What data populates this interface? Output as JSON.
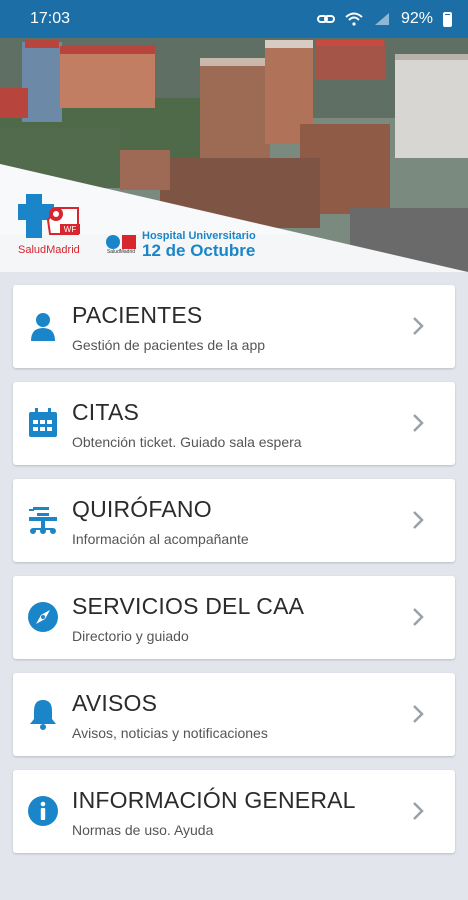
{
  "status_bar": {
    "time": "17:03",
    "battery": "92%"
  },
  "header": {
    "left_logo": {
      "badge_text": "WF",
      "name": "SaludMadrid"
    },
    "right_logo": {
      "small": "SaludMadrid",
      "line1": "Hospital Universitario",
      "line2": "12 de Octubre"
    }
  },
  "colors": {
    "accent": "#1a86c9",
    "status_bar": "#1c6fa6",
    "background": "#e2e6ec",
    "logo_red": "#d7262e"
  },
  "menu": [
    {
      "title": "PACIENTES",
      "subtitle": "Gestión de pacientes de la app",
      "icon": "person-icon"
    },
    {
      "title": "CITAS",
      "subtitle": "Obtención ticket. Guiado sala espera",
      "icon": "calendar-icon"
    },
    {
      "title": "QUIRÓFANO",
      "subtitle": "Información al acompañante",
      "icon": "operating-table-icon"
    },
    {
      "title": "SERVICIOS DEL CAA",
      "subtitle": "Directorio y guiado",
      "icon": "compass-icon"
    },
    {
      "title": "AVISOS",
      "subtitle": "Avisos, noticias y notificaciones",
      "icon": "bell-icon"
    },
    {
      "title": "INFORMACIÓN GENERAL",
      "subtitle": "Normas de uso. Ayuda",
      "icon": "info-icon"
    }
  ]
}
